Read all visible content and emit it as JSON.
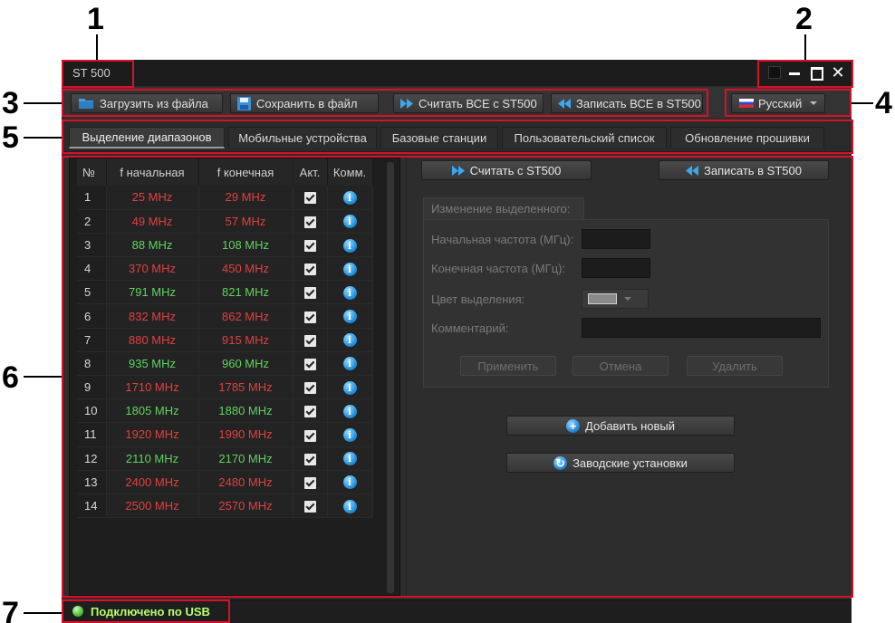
{
  "callouts": [
    "1",
    "2",
    "3",
    "4",
    "5",
    "6",
    "7"
  ],
  "window": {
    "title": "ST 500"
  },
  "toolbar": {
    "load_label": "Загрузить из файла",
    "save_label": "Сохранить в файл",
    "read_all_label": "Считать ВСЕ с ST500",
    "write_all_label": "Записать ВСЕ в ST500",
    "language": "Русский"
  },
  "tabs": [
    {
      "label": "Выделение диапазонов",
      "active": true
    },
    {
      "label": "Мобильные устройства",
      "active": false
    },
    {
      "label": "Базовые станции",
      "active": false
    },
    {
      "label": "Пользовательский список",
      "active": false
    },
    {
      "label": "Обновление прошивки",
      "active": false
    }
  ],
  "table": {
    "headers": [
      "№",
      "f начальная",
      "f конечная",
      "Акт.",
      "Комм."
    ],
    "rows": [
      {
        "n": "1",
        "start": "25 MHz",
        "end": "29 MHz",
        "color": "red",
        "active": true
      },
      {
        "n": "2",
        "start": "49 MHz",
        "end": "57 MHz",
        "color": "red",
        "active": true
      },
      {
        "n": "3",
        "start": "88 MHz",
        "end": "108 MHz",
        "color": "green",
        "active": true
      },
      {
        "n": "4",
        "start": "370 MHz",
        "end": "450 MHz",
        "color": "red",
        "active": true
      },
      {
        "n": "5",
        "start": "791 MHz",
        "end": "821 MHz",
        "color": "green",
        "active": true
      },
      {
        "n": "6",
        "start": "832 MHz",
        "end": "862 MHz",
        "color": "red",
        "active": true
      },
      {
        "n": "7",
        "start": "880 MHz",
        "end": "915 MHz",
        "color": "red",
        "active": true
      },
      {
        "n": "8",
        "start": "935 MHz",
        "end": "960 MHz",
        "color": "green",
        "active": true
      },
      {
        "n": "9",
        "start": "1710 MHz",
        "end": "1785 MHz",
        "color": "red",
        "active": true
      },
      {
        "n": "10",
        "start": "1805 MHz",
        "end": "1880 MHz",
        "color": "green",
        "active": true
      },
      {
        "n": "11",
        "start": "1920 MHz",
        "end": "1990 MHz",
        "color": "red",
        "active": true
      },
      {
        "n": "12",
        "start": "2110 MHz",
        "end": "2170 MHz",
        "color": "green",
        "active": true
      },
      {
        "n": "13",
        "start": "2400 MHz",
        "end": "2480 MHz",
        "color": "red",
        "active": true
      },
      {
        "n": "14",
        "start": "2500 MHz",
        "end": "2570 MHz",
        "color": "red",
        "active": true
      }
    ]
  },
  "right": {
    "read_label": "Считать с ST500",
    "write_label": "Записать в ST500",
    "group_title": "Изменение выделенного:",
    "start_freq_label": "Начальная частота (МГц):",
    "end_freq_label": "Конечная частота (МГц):",
    "color_label": "Цвет выделения:",
    "comment_label": "Комментарий:",
    "apply_label": "Применить",
    "cancel_label": "Отмена",
    "delete_label": "Удалить",
    "add_label": "Добавить новый",
    "factory_label": "Заводские установки"
  },
  "status": {
    "text": "Подключено по USB"
  },
  "colors": {
    "red": "#e04040",
    "green": "#5fd35f",
    "status": "#b9ff6a",
    "callout_box": "#d8102a"
  },
  "icons": [
    "folder-icon",
    "floppy-icon",
    "fast-forward-icon",
    "rewind-icon",
    "flag-icon",
    "info-icon",
    "plus-icon",
    "refresh-icon",
    "status-led-icon"
  ]
}
